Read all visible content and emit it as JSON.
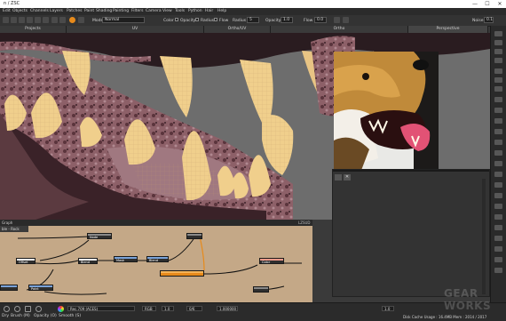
{
  "window": {
    "title": "n / ZSC",
    "min": "—",
    "max": "☐",
    "close": "✕"
  },
  "menu": [
    "Edit",
    "Objects",
    "Channels",
    "Layers",
    "Patches",
    "Paint",
    "Shading",
    "Painting",
    "Filters",
    "Camera",
    "View",
    "Tools",
    "Python",
    "Hair",
    "Help"
  ],
  "toolbar": {
    "mode_label": "Mode",
    "mode_value": "Normal",
    "color_label": "Color",
    "opacity_label": "Opacity",
    "radius_label": "Radius",
    "flow_label": "Flow",
    "radius2_label": "Radius",
    "radius2_value": "5",
    "opacity2_label": "Opacity",
    "opacity2_value": "1.0",
    "flow2_label": "Flow",
    "flow2_value": "0.0",
    "noise_label": "Noise",
    "noise_value": "0.1"
  },
  "view_tabs": [
    "Projects",
    "UV",
    "Ortho/UV",
    "Ortho",
    "Perspective"
  ],
  "node_panel": {
    "title": "Graph",
    "tab": "ble - Rock",
    "logo": "LZSUD",
    "nodes": [
      "Node",
      "Offset",
      "Blend",
      "Mask",
      "Blend",
      "Color",
      "Paint"
    ]
  },
  "status": {
    "color_space": "Rec.709 (ACES)",
    "channel": "RGB",
    "gamma": "1.0",
    "exposure": "1.000000",
    "page": "0/6",
    "dry_label": "Dry",
    "brush_label": "Brush (M)",
    "opacity_label": "Opacity (O)",
    "smooth_label": "Smooth (S)",
    "zoom": "1.0",
    "cache": "Disk Cache Usage : 16.4MB  Mem : 2014 / 2017",
    "watermark": "GEAR WORKS"
  },
  "colors": {
    "accent_orange": "#e78a1b",
    "node_bg": "#c4a887",
    "gum": "#8a5c64",
    "tooth": "#f0cf8c"
  }
}
